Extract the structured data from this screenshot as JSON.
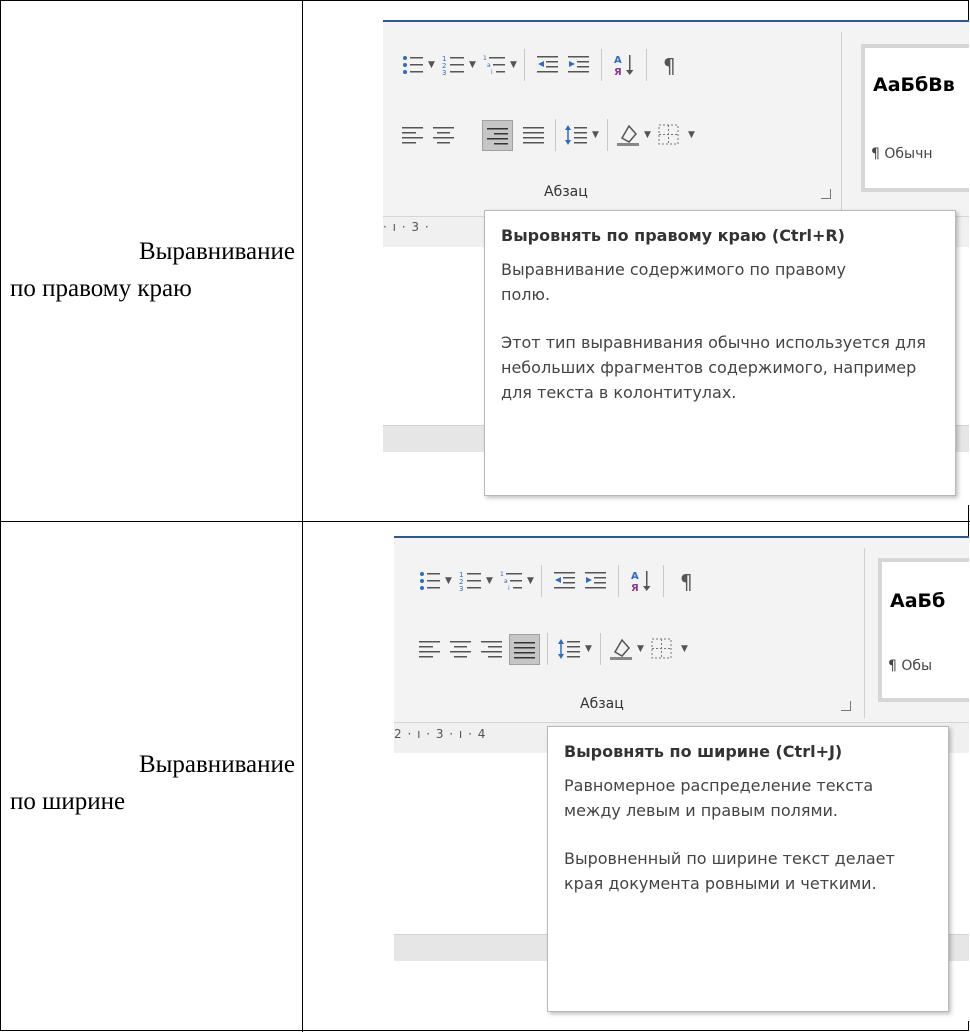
{
  "rows": [
    {
      "label_line1": "Выравнивание",
      "label_line2": "по правому краю",
      "group_label": "Абзац",
      "styles_preview": "АаБбВв",
      "styles_name": "¶ Обычн",
      "ruler": "· ı · 3 ·",
      "selected_button": "align-right",
      "tooltip": {
        "title": "Выровнять по правому краю (Ctrl+R)",
        "p1": "Выравнивание содержимого по правому полю.",
        "p2": "Этот тип выравнивания обычно используется для небольших фрагментов содержимого, например для текста в колонтитулах."
      }
    },
    {
      "label_line1": "Выравнивание",
      "label_line2": "по ширине",
      "group_label": "Абзац",
      "styles_preview": "АаБб",
      "styles_name": "¶ Обы",
      "ruler": "2 · ı · 3 · ı · 4",
      "selected_button": "justify",
      "tooltip": {
        "title": "Выровнять по ширине (Ctrl+J)",
        "p1": "Равномерное распределение текста между левым и правым полями.",
        "p2": "Выровненный по ширине текст делает края документа ровными и четкими."
      }
    }
  ],
  "icons": [
    "bullets-icon",
    "numbering-icon",
    "multilevel-list-icon",
    "decrease-indent-icon",
    "increase-indent-icon",
    "sort-icon",
    "show-marks-icon",
    "align-left-icon",
    "align-center-icon",
    "align-right-icon",
    "justify-icon",
    "line-spacing-icon",
    "shading-icon",
    "borders-icon",
    "dialog-launcher-icon"
  ],
  "colors": {
    "accent": "#2b579a",
    "selected": "#c6c6c6",
    "icon_blue": "#2b6cc4"
  }
}
